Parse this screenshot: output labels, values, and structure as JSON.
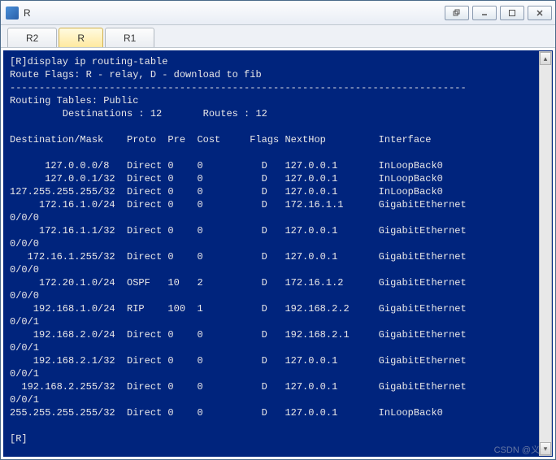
{
  "window": {
    "title": "R"
  },
  "tabs": [
    {
      "label": "R2",
      "selected": false
    },
    {
      "label": "R",
      "selected": true
    },
    {
      "label": "R1",
      "selected": false
    }
  ],
  "terminal": {
    "prompt_command": "[R]display ip routing-table",
    "flags_legend": "Route Flags: R - relay, D - download to fib",
    "divider": "------------------------------------------------------------------------------",
    "tables_header": "Routing Tables: Public",
    "counts_line": "         Destinations : 12       Routes : 12",
    "columns": "Destination/Mask    Proto  Pre  Cost     Flags NextHop         Interface",
    "rows": [
      {
        "dest": "      127.0.0.0/8",
        "proto": "Direct",
        "pre": "0",
        "cost": "0",
        "flags": "D",
        "nexthop": "127.0.0.1",
        "iface": "InLoopBack0",
        "wrap": ""
      },
      {
        "dest": "      127.0.0.1/32",
        "proto": "Direct",
        "pre": "0",
        "cost": "0",
        "flags": "D",
        "nexthop": "127.0.0.1",
        "iface": "InLoopBack0",
        "wrap": ""
      },
      {
        "dest": "127.255.255.255/32",
        "proto": "Direct",
        "pre": "0",
        "cost": "0",
        "flags": "D",
        "nexthop": "127.0.0.1",
        "iface": "InLoopBack0",
        "wrap": ""
      },
      {
        "dest": "     172.16.1.0/24",
        "proto": "Direct",
        "pre": "0",
        "cost": "0",
        "flags": "D",
        "nexthop": "172.16.1.1",
        "iface": "GigabitEthernet",
        "wrap": "0/0/0"
      },
      {
        "dest": "     172.16.1.1/32",
        "proto": "Direct",
        "pre": "0",
        "cost": "0",
        "flags": "D",
        "nexthop": "127.0.0.1",
        "iface": "GigabitEthernet",
        "wrap": "0/0/0"
      },
      {
        "dest": "   172.16.1.255/32",
        "proto": "Direct",
        "pre": "0",
        "cost": "0",
        "flags": "D",
        "nexthop": "127.0.0.1",
        "iface": "GigabitEthernet",
        "wrap": "0/0/0"
      },
      {
        "dest": "     172.20.1.0/24",
        "proto": "OSPF",
        "pre": "10",
        "cost": "2",
        "flags": "D",
        "nexthop": "172.16.1.2",
        "iface": "GigabitEthernet",
        "wrap": "0/0/0"
      },
      {
        "dest": "    192.168.1.0/24",
        "proto": "RIP",
        "pre": "100",
        "cost": "1",
        "flags": "D",
        "nexthop": "192.168.2.2",
        "iface": "GigabitEthernet",
        "wrap": "0/0/1"
      },
      {
        "dest": "    192.168.2.0/24",
        "proto": "Direct",
        "pre": "0",
        "cost": "0",
        "flags": "D",
        "nexthop": "192.168.2.1",
        "iface": "GigabitEthernet",
        "wrap": "0/0/1"
      },
      {
        "dest": "    192.168.2.1/32",
        "proto": "Direct",
        "pre": "0",
        "cost": "0",
        "flags": "D",
        "nexthop": "127.0.0.1",
        "iface": "GigabitEthernet",
        "wrap": "0/0/1"
      },
      {
        "dest": "  192.168.2.255/32",
        "proto": "Direct",
        "pre": "0",
        "cost": "0",
        "flags": "D",
        "nexthop": "127.0.0.1",
        "iface": "GigabitEthernet",
        "wrap": "0/0/1"
      },
      {
        "dest": "255.255.255.255/32",
        "proto": "Direct",
        "pre": "0",
        "cost": "0",
        "flags": "D",
        "nexthop": "127.0.0.1",
        "iface": "InLoopBack0",
        "wrap": ""
      }
    ],
    "end_prompt": "[R]"
  },
  "watermark": "CSDN @义一"
}
